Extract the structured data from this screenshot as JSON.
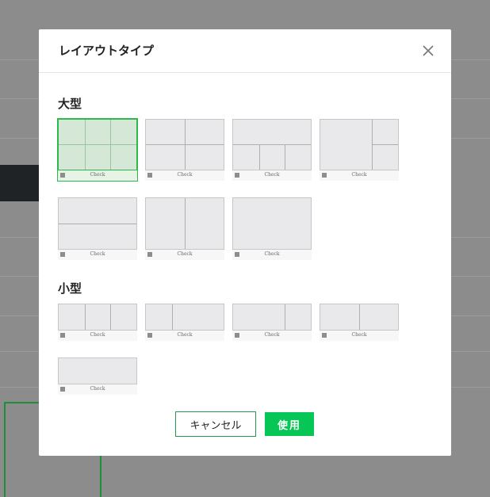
{
  "dialog": {
    "title": "レイアウトタイプ",
    "close_icon": "close-icon"
  },
  "sections": {
    "large": {
      "title": "大型",
      "selected_index": 0,
      "layouts": [
        {
          "id": "large-6-grid",
          "check_label": "Check"
        },
        {
          "id": "large-4-grid",
          "check_label": "Check"
        },
        {
          "id": "large-1-top-3-bottom",
          "check_label": "Check"
        },
        {
          "id": "large-1-left-2-right",
          "check_label": "Check"
        },
        {
          "id": "large-2-rows",
          "check_label": "Check"
        },
        {
          "id": "large-2-cols",
          "check_label": "Check"
        },
        {
          "id": "large-1-full",
          "check_label": "Check"
        }
      ]
    },
    "small": {
      "title": "小型",
      "layouts": [
        {
          "id": "small-3-cols",
          "check_label": "Check"
        },
        {
          "id": "small-1-narrow-1-wide",
          "check_label": "Check"
        },
        {
          "id": "small-1-wide-1-narrow",
          "check_label": "Check"
        },
        {
          "id": "small-2-cols",
          "check_label": "Check"
        },
        {
          "id": "small-1-full",
          "check_label": "Check"
        }
      ]
    }
  },
  "buttons": {
    "cancel": "キャンセル",
    "use": "使用"
  },
  "colors": {
    "accent": "#06c755",
    "selected_border": "#2db84b",
    "selected_fill": "#d5e7d6",
    "overlay": "#8c8c8c"
  }
}
